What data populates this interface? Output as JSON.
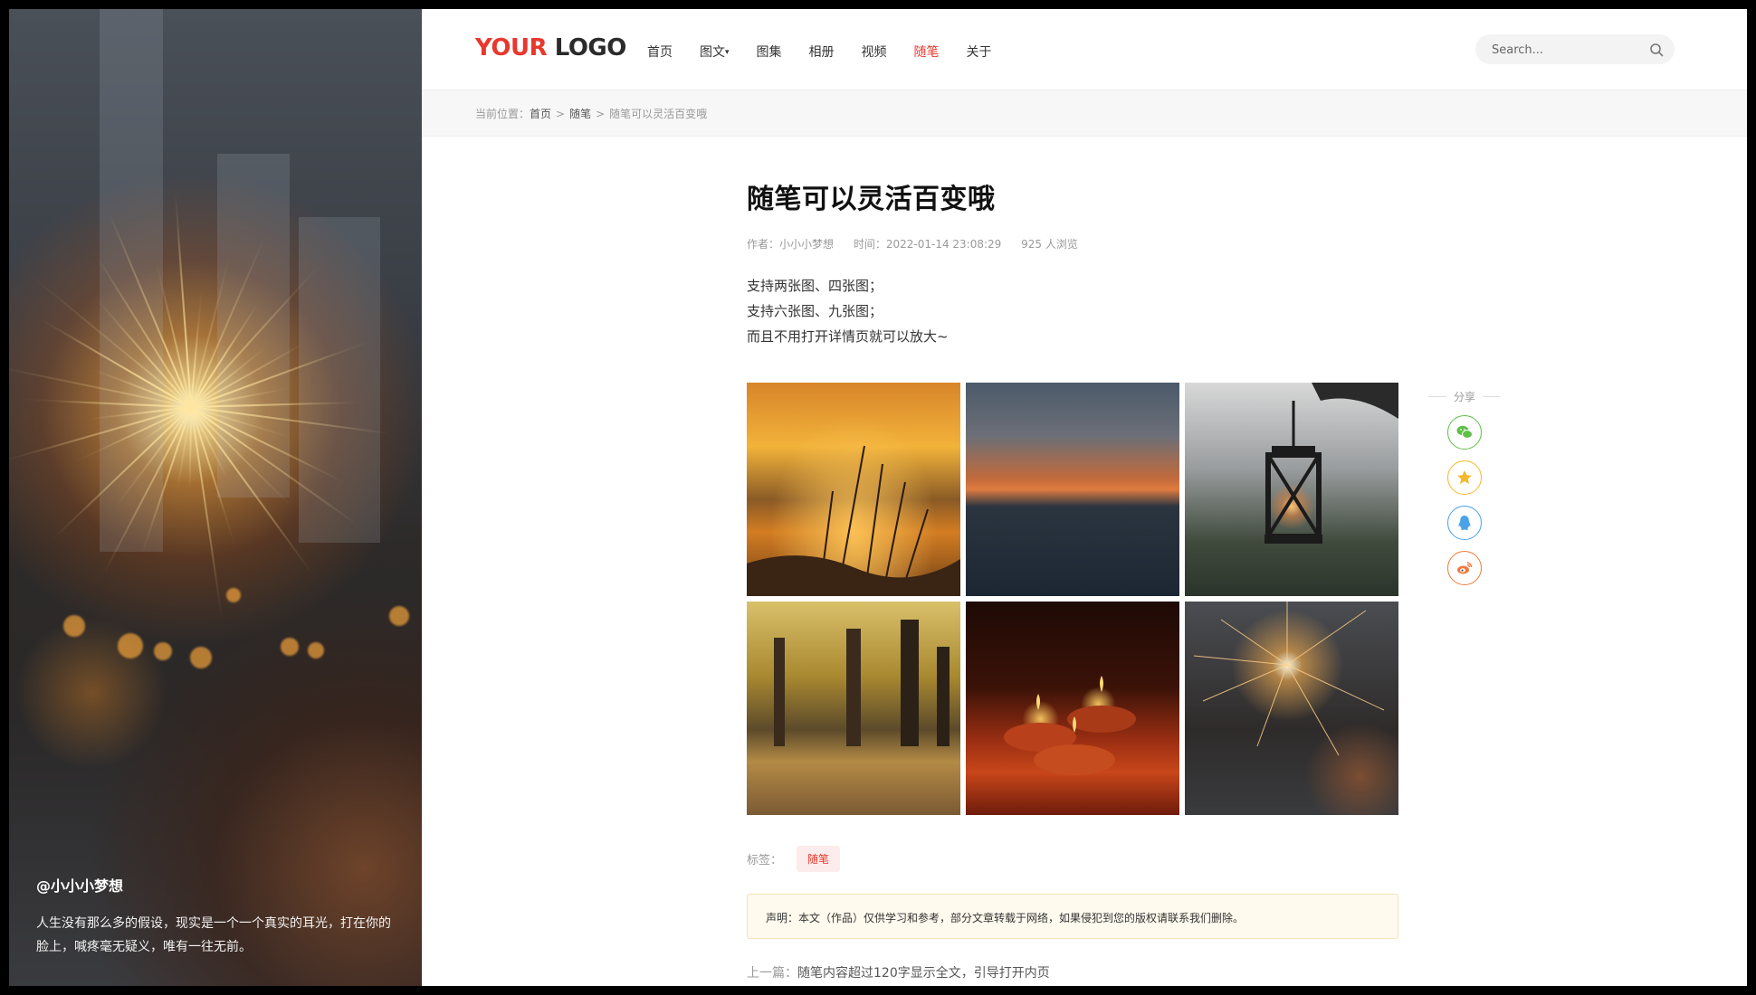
{
  "hero": {
    "handle": "@小小小梦想",
    "quote": "人生没有那么多的假设，现实是一个一个真实的耳光，打在你的脸上，喊疼毫无疑义，唯有一往无前。"
  },
  "header": {
    "logo_part1": "YOUR",
    "logo_part2": " LOGO",
    "nav": [
      {
        "label": "首页"
      },
      {
        "label": "图文"
      },
      {
        "label": "图集"
      },
      {
        "label": "相册"
      },
      {
        "label": "视频"
      },
      {
        "label": "随笔"
      },
      {
        "label": "关于"
      }
    ],
    "search_placeholder": "Search..."
  },
  "breadcrumb": {
    "prefix": "当前位置：",
    "items": [
      "首页",
      "随笔",
      "随笔可以灵活百变哦"
    ],
    "separator": ">"
  },
  "article": {
    "title": "随笔可以灵活百变哦",
    "author": "作者：小小小梦想",
    "time": "时间：2022-01-14 23:08:29",
    "views": "925 人浏览",
    "lines": [
      "支持两张图、四张图；",
      "支持六张图、九张图；",
      "而且不用打开详情页就可以放大~"
    ]
  },
  "share": {
    "label": "分享",
    "buttons": [
      {
        "icon": "wechat-icon",
        "color": "#5fbf4a"
      },
      {
        "icon": "qzone-icon",
        "color": "#f5b92a"
      },
      {
        "icon": "qq-icon",
        "color": "#4aa3e8"
      },
      {
        "icon": "weibo-icon",
        "color": "#f07a3a"
      }
    ]
  },
  "tags": {
    "label": "标签：",
    "items": [
      "随笔"
    ]
  },
  "notice": "声明：本文（作品）仅供学习和参考，部分文章转载于网络，如果侵犯到您的版权请联系我们删除。",
  "prev": {
    "label": "上一篇：",
    "title": "随笔内容超过120字显示全文，引导打开内页"
  },
  "colors": {
    "accent": "#e8382d"
  }
}
